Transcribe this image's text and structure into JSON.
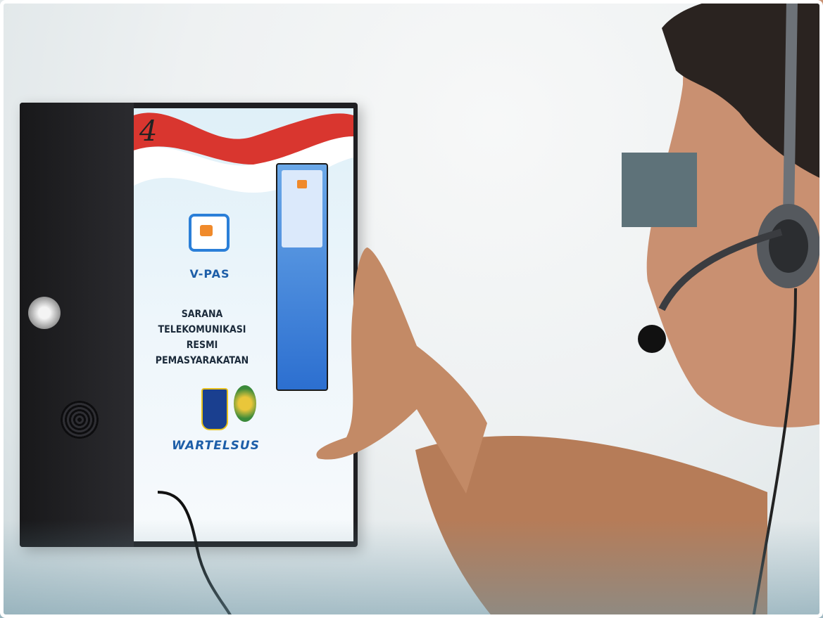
{
  "photo": {
    "booth_number": "4",
    "kiosk": {
      "brand": "V-PAS",
      "heading_lines": [
        "SARANA TELEKOMUNIKASI",
        "RESMI PEMASYARAKATAN"
      ],
      "provider": "WARTELSUS"
    },
    "colors": {
      "flag_red": "#d9362f",
      "brand_blue": "#1d5ea8",
      "brand_orange": "#f08a2b",
      "kiosk_body": "#1f1f22",
      "skin": "#c38a66",
      "censor": "#5e7279"
    }
  }
}
